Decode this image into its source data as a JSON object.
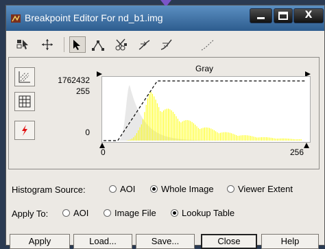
{
  "window": {
    "title": "Breakpoint Editor For nd_b1.img",
    "controls": {
      "minimize": "—",
      "maximize": "☐",
      "close": "X"
    }
  },
  "toolbar": {
    "tools": [
      "select-area-icon",
      "pan-icon",
      "pointer-icon",
      "add-breakpoint-icon",
      "delete-breakpoint-icon",
      "curve-icon-1",
      "curve-icon-2",
      "dotted-curve-icon"
    ]
  },
  "side_tools": [
    "chart-options-icon",
    "table-icon",
    "function-icon"
  ],
  "chart_data": {
    "type": "area",
    "title": "Gray",
    "y_ticks": [
      "1762432",
      "255",
      "0"
    ],
    "x_ticks": [
      "0",
      "256"
    ],
    "xlim": [
      0,
      256
    ],
    "lookup_breakpoints": [
      [
        0,
        0
      ],
      [
        18,
        0
      ],
      [
        68,
        255
      ],
      [
        256,
        255
      ]
    ],
    "series": [
      {
        "color": "#ffff00",
        "peak_x": 60
      },
      {
        "color": "#e8e8e8",
        "peak_x": 33
      }
    ]
  },
  "histogram_source": {
    "label": "Histogram Source:",
    "options": [
      "AOI",
      "Whole Image",
      "Viewer Extent"
    ],
    "selected": "Whole Image"
  },
  "apply_to": {
    "label": "Apply To:",
    "options": [
      "AOI",
      "Image File",
      "Lookup Table"
    ],
    "selected": "Lookup Table"
  },
  "buttons": {
    "apply": "Apply",
    "load": "Load...",
    "save": "Save...",
    "close": "Close",
    "help": "Help"
  }
}
